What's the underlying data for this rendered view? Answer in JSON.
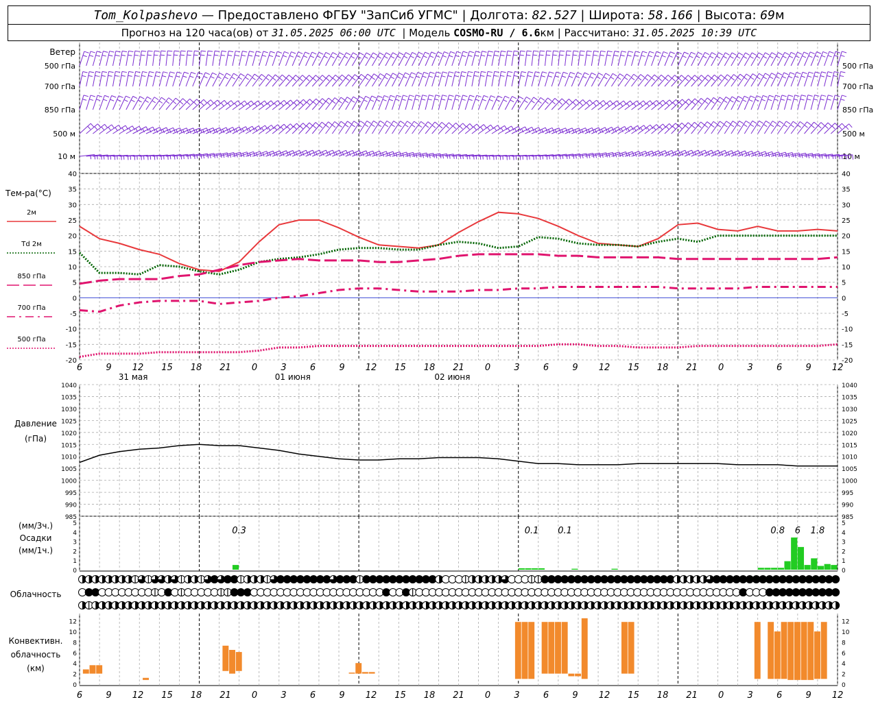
{
  "header": {
    "station": "Tom_Kolpashevo",
    "provider_sep": " — ",
    "provider": "Предоставлено ФГБУ \"ЗапСиб УГМС\"",
    "lon_label": "Долгота:",
    "lon_value": "82.527",
    "lat_label": "Широта:",
    "lat_value": "58.166",
    "alt_label": "Высота:",
    "alt_value": "69",
    "alt_unit": "м",
    "forecast_label": "Прогноз на 120 часа(ов) от",
    "forecast_time": "31.05.2025 06:00 UTC",
    "model_label": "Модель",
    "model_name": "COSMO-RU / 6.6",
    "model_unit": "км",
    "calc_label": "Рассчитано:",
    "calc_time": "31.05.2025 10:39 UTC"
  },
  "labels": {
    "wind_title": "Ветер",
    "wind_levels": [
      "500 гПа",
      "700 гПа",
      "850 гПа",
      "500 м",
      "10  м"
    ],
    "temp_title": "Тем-ра(°C)",
    "temp_legend": [
      "2м",
      "Td  2м",
      "850 гПа",
      "700 гПа",
      "500 гПа"
    ],
    "pressure_title": "Давление",
    "pressure_unit": "(гПа)",
    "precip_unit3": "(мм/3ч.)",
    "precip_title": "Осадки",
    "precip_unit1": "(мм/1ч.)",
    "cloud_title": "Облачность",
    "conv_title1": "Конвективн.",
    "conv_title2": "облачность",
    "conv_unit": "(км)"
  },
  "colors": {
    "t2m": "#e8383b",
    "td2m": "#006400",
    "t850": "#e0146e",
    "t700": "#e0146e",
    "t500": "#e0146e",
    "wind": "#7a2bd1",
    "zero_line": "#2030d0",
    "pressure": "#000000",
    "precip": "#22cc22",
    "conv": "#f28a2c"
  },
  "chart_data": [
    {
      "type": "line",
      "title": "Тем-ра(°C)",
      "ylim": [
        -20,
        40
      ],
      "x_hours": [
        0,
        3,
        6,
        9,
        12,
        15,
        18,
        21,
        24,
        27,
        30,
        33,
        36,
        39,
        42,
        45,
        48,
        51,
        54,
        57,
        60,
        63,
        66,
        69,
        72,
        75,
        78,
        81,
        84,
        87,
        90,
        93,
        96,
        99,
        102,
        105,
        108,
        111,
        114
      ],
      "tick_labels": [
        "6",
        "9",
        "12",
        "15",
        "18",
        "21",
        "0",
        "3",
        "6",
        "9",
        "12",
        "15",
        "18",
        "21",
        "0",
        "3",
        "6",
        "9",
        "12",
        "15",
        "18",
        "21",
        "0",
        "3",
        "6",
        "9",
        "12"
      ],
      "date_labels": [
        "31 мая",
        "01 июня",
        "02 июня"
      ],
      "series": [
        {
          "name": "2м",
          "style": "solid",
          "values": [
            23,
            19,
            17.5,
            15.5,
            14,
            11,
            9,
            8.5,
            11.5,
            18,
            23.5,
            25,
            25,
            22.5,
            19.5,
            17,
            16.5,
            16,
            17,
            21,
            24.5,
            27.5,
            27,
            25.5,
            23,
            20,
            17.5,
            17,
            16.5,
            19,
            23.5,
            24,
            22,
            21.5,
            23,
            21.5,
            21.5,
            22,
            21.5
          ]
        },
        {
          "name": "Td  2м",
          "style": "dotted",
          "values": [
            14.5,
            8,
            8,
            7.5,
            10.5,
            10,
            8.5,
            7.5,
            9,
            11.5,
            12.5,
            13,
            14,
            15.5,
            16,
            16,
            15.5,
            15.5,
            17,
            18,
            17.5,
            16,
            16.5,
            19.5,
            19,
            17.5,
            17,
            17,
            16.5,
            18,
            19,
            18,
            20,
            20,
            20,
            20,
            20,
            20,
            20
          ]
        },
        {
          "name": "850 гПа",
          "style": "dashed",
          "values": [
            4.5,
            5.5,
            6,
            6,
            6,
            7,
            7.5,
            9,
            10.5,
            11.5,
            12,
            12.5,
            12,
            12,
            12,
            11.5,
            11.5,
            12,
            12.5,
            13.5,
            14,
            14,
            14,
            14,
            13.5,
            13.5,
            13,
            13,
            13,
            13,
            12.5,
            12.5,
            12.5,
            12.5,
            12.5,
            12.5,
            12.5,
            12.5,
            13
          ]
        },
        {
          "name": "700 гПа",
          "style": "dashdot",
          "values": [
            -4,
            -4.5,
            -2.5,
            -1.5,
            -1,
            -1,
            -1,
            -2,
            -1.5,
            -1,
            0,
            0.5,
            1.5,
            2.5,
            3,
            3,
            2.5,
            2,
            2,
            2,
            2.5,
            2.5,
            3,
            3,
            3.5,
            3.5,
            3.5,
            3.5,
            3.5,
            3.5,
            3,
            3,
            3,
            3,
            3.5,
            3.5,
            3.5,
            3.5,
            3.5
          ]
        },
        {
          "name": "500 гПа",
          "style": "dotted",
          "values": [
            -19,
            -18,
            -18,
            -18,
            -17.5,
            -17.5,
            -17.5,
            -17.5,
            -17.5,
            -17,
            -16,
            -16,
            -15.5,
            -15.5,
            -15.5,
            -15.5,
            -15.5,
            -15.5,
            -15.5,
            -15.5,
            -15.5,
            -15.5,
            -15.5,
            -15.5,
            -15,
            -15,
            -15.5,
            -15.5,
            -16,
            -16,
            -16,
            -15.5,
            -15.5,
            -15.5,
            -15.5,
            -15.5,
            -15.5,
            -15.5,
            -15
          ]
        }
      ]
    },
    {
      "type": "line",
      "title": "Давление",
      "ylim": [
        985,
        1040
      ],
      "y_ticks": [
        985,
        990,
        995,
        1000,
        1005,
        1010,
        1015,
        1020,
        1025,
        1030,
        1035,
        1040
      ],
      "x_hours": [
        0,
        3,
        6,
        9,
        12,
        15,
        18,
        21,
        24,
        27,
        30,
        33,
        36,
        39,
        42,
        45,
        48,
        51,
        54,
        57,
        60,
        63,
        66,
        69,
        72,
        75,
        78,
        81,
        84,
        87,
        90,
        93,
        96,
        99,
        102,
        105,
        108,
        111,
        114
      ],
      "series": [
        {
          "name": "Давление",
          "values": [
            1007.5,
            1010.5,
            1012,
            1013,
            1013.5,
            1014.5,
            1015,
            1014.5,
            1014.5,
            1013.5,
            1012.5,
            1011,
            1010,
            1009,
            1008.5,
            1008.5,
            1009,
            1009,
            1009.5,
            1009.5,
            1009.5,
            1009,
            1008,
            1007,
            1007,
            1006.5,
            1006.5,
            1006.5,
            1007,
            1007,
            1007,
            1007,
            1007,
            1006.5,
            1006.5,
            1006.5,
            1006,
            1006,
            1006
          ]
        }
      ]
    },
    {
      "type": "bar",
      "title": "Осадки",
      "ylim": [
        0,
        5
      ],
      "hours": [
        23,
        66,
        67,
        68,
        69,
        74,
        80,
        102,
        103,
        104,
        105,
        106,
        107,
        108,
        109,
        110,
        111,
        112,
        113
      ],
      "values": [
        0.5,
        0.15,
        0.15,
        0.15,
        0.15,
        0.1,
        0.1,
        0.2,
        0.2,
        0.2,
        0.2,
        0.9,
        3.4,
        2.4,
        0.5,
        1.2,
        0.4,
        0.6,
        0.5
      ],
      "sum_labels": [
        {
          "hour": 24,
          "text": "0.3"
        },
        {
          "hour": 68,
          "text": "0.1"
        },
        {
          "hour": 73,
          "text": "0.1"
        },
        {
          "hour": 105,
          "text": "0.8"
        },
        {
          "hour": 108,
          "text": "6"
        },
        {
          "hour": 111,
          "text": "1.8"
        }
      ]
    },
    {
      "type": "bar",
      "title": "Конвективн. облачность",
      "ylim": [
        0,
        13
      ],
      "y_ticks": [
        0,
        2,
        4,
        6,
        8,
        10,
        12
      ],
      "bars": [
        {
          "h": 1,
          "base": 2,
          "top": 2.8
        },
        {
          "h": 2,
          "base": 2,
          "top": 3.6
        },
        {
          "h": 3,
          "base": 2,
          "top": 3.6
        },
        {
          "h": 10,
          "base": 0.8,
          "top": 1.2
        },
        {
          "h": 22,
          "base": 2.5,
          "top": 7.3
        },
        {
          "h": 23,
          "base": 2,
          "top": 6.5
        },
        {
          "h": 24,
          "base": 2.5,
          "top": 6.1
        },
        {
          "h": 41,
          "base": 2,
          "top": 2.2
        },
        {
          "h": 42,
          "base": 2,
          "top": 4
        },
        {
          "h": 43,
          "base": 2,
          "top": 2.3
        },
        {
          "h": 44,
          "base": 2,
          "top": 2.3
        },
        {
          "h": 66,
          "base": 1,
          "top": 11.8
        },
        {
          "h": 67,
          "base": 1,
          "top": 11.8
        },
        {
          "h": 68,
          "base": 1,
          "top": 11.8
        },
        {
          "h": 70,
          "base": 2,
          "top": 11.8
        },
        {
          "h": 71,
          "base": 2,
          "top": 11.8
        },
        {
          "h": 72,
          "base": 2,
          "top": 11.8
        },
        {
          "h": 73,
          "base": 2,
          "top": 11.8
        },
        {
          "h": 74,
          "base": 1.5,
          "top": 2
        },
        {
          "h": 75,
          "base": 1.5,
          "top": 2
        },
        {
          "h": 76,
          "base": 1,
          "top": 12.5
        },
        {
          "h": 82,
          "base": 2,
          "top": 11.8
        },
        {
          "h": 83,
          "base": 2,
          "top": 11.8
        },
        {
          "h": 102,
          "base": 1,
          "top": 11.8
        },
        {
          "h": 104,
          "base": 1,
          "top": 11.8
        },
        {
          "h": 105,
          "base": 1,
          "top": 10
        },
        {
          "h": 106,
          "base": 1,
          "top": 11.8
        },
        {
          "h": 107,
          "base": 0.8,
          "top": 11.8
        },
        {
          "h": 108,
          "base": 0.8,
          "top": 11.8
        },
        {
          "h": 109,
          "base": 0.8,
          "top": 11.8
        },
        {
          "h": 110,
          "base": 0.8,
          "top": 11.8
        },
        {
          "h": 111,
          "base": 1,
          "top": 10
        },
        {
          "h": 112,
          "base": 1,
          "top": 11.8
        }
      ]
    }
  ],
  "cloud_rows": {
    "upper": [
      2,
      2,
      2,
      2,
      2,
      2,
      2,
      2,
      1,
      3,
      1,
      3,
      3,
      2,
      3,
      1,
      2,
      2,
      1,
      3,
      4,
      3,
      4,
      4,
      1,
      2,
      2,
      2,
      1,
      3,
      4,
      4,
      4,
      4,
      4,
      4,
      4,
      4,
      3,
      4,
      4,
      4,
      1,
      4,
      4,
      4,
      4,
      4,
      4,
      4,
      4,
      4,
      4,
      4,
      2,
      0,
      0,
      0,
      1,
      2,
      2,
      2,
      2,
      2,
      3,
      0,
      0,
      0,
      1,
      1,
      4,
      4,
      4,
      4,
      4,
      4,
      4,
      4,
      4,
      4,
      4,
      4,
      4,
      4,
      4,
      4,
      4,
      4,
      4,
      4,
      2,
      2,
      2,
      2,
      2,
      3,
      4,
      4,
      4,
      4,
      4,
      4,
      4,
      4,
      4,
      4,
      4,
      4,
      4,
      4,
      4,
      4,
      4,
      4,
      4
    ],
    "middle": [
      0,
      4,
      4,
      0,
      0,
      0,
      0,
      0,
      0,
      0,
      0,
      1,
      0,
      4,
      0,
      1,
      0,
      0,
      0,
      0,
      0,
      1,
      1,
      4,
      4,
      4,
      0,
      0,
      0,
      0,
      0,
      0,
      0,
      0,
      0,
      0,
      0,
      0,
      0,
      0,
      0,
      0,
      0,
      0,
      0,
      0,
      4,
      0,
      0,
      4,
      1,
      0,
      0,
      0,
      0,
      0,
      0,
      0,
      0,
      0,
      0,
      0,
      0,
      0,
      0,
      0,
      0,
      0,
      0,
      0,
      0,
      0,
      0,
      0,
      0,
      0,
      0,
      0,
      0,
      0,
      0,
      0,
      0,
      0,
      0,
      0,
      0,
      0,
      0,
      0,
      0,
      0,
      0,
      0,
      0,
      0,
      0,
      0,
      0,
      0,
      4,
      0,
      0,
      0,
      4,
      4,
      4,
      4,
      4,
      4,
      4,
      4,
      4,
      4,
      4,
      4,
      4,
      4,
      4,
      4
    ],
    "lower": [
      2,
      1,
      2,
      2,
      2,
      2,
      2,
      2,
      2,
      2,
      2,
      2,
      2,
      2,
      2,
      2,
      2,
      2,
      2,
      2,
      2,
      2,
      2,
      2,
      2,
      2,
      2,
      2,
      2,
      2,
      2,
      2,
      2,
      2,
      2,
      2,
      2,
      2,
      2,
      2,
      2,
      2,
      2,
      2,
      2,
      2,
      2,
      2,
      2,
      2,
      2,
      2,
      2,
      2,
      2,
      2,
      2,
      2,
      2,
      2,
      2,
      2,
      2,
      2,
      2,
      2,
      2,
      2,
      2,
      2,
      2,
      2,
      2,
      2,
      2,
      2,
      2,
      2,
      2,
      2,
      2,
      2,
      2,
      2,
      2,
      2,
      2,
      2,
      2,
      2,
      2,
      2,
      2,
      2,
      2,
      2,
      2,
      2,
      2,
      2,
      2,
      2,
      2,
      2,
      2,
      2,
      2,
      2,
      2,
      2,
      2,
      2,
      2,
      2,
      2,
      2,
      2,
      2,
      2
    ]
  }
}
